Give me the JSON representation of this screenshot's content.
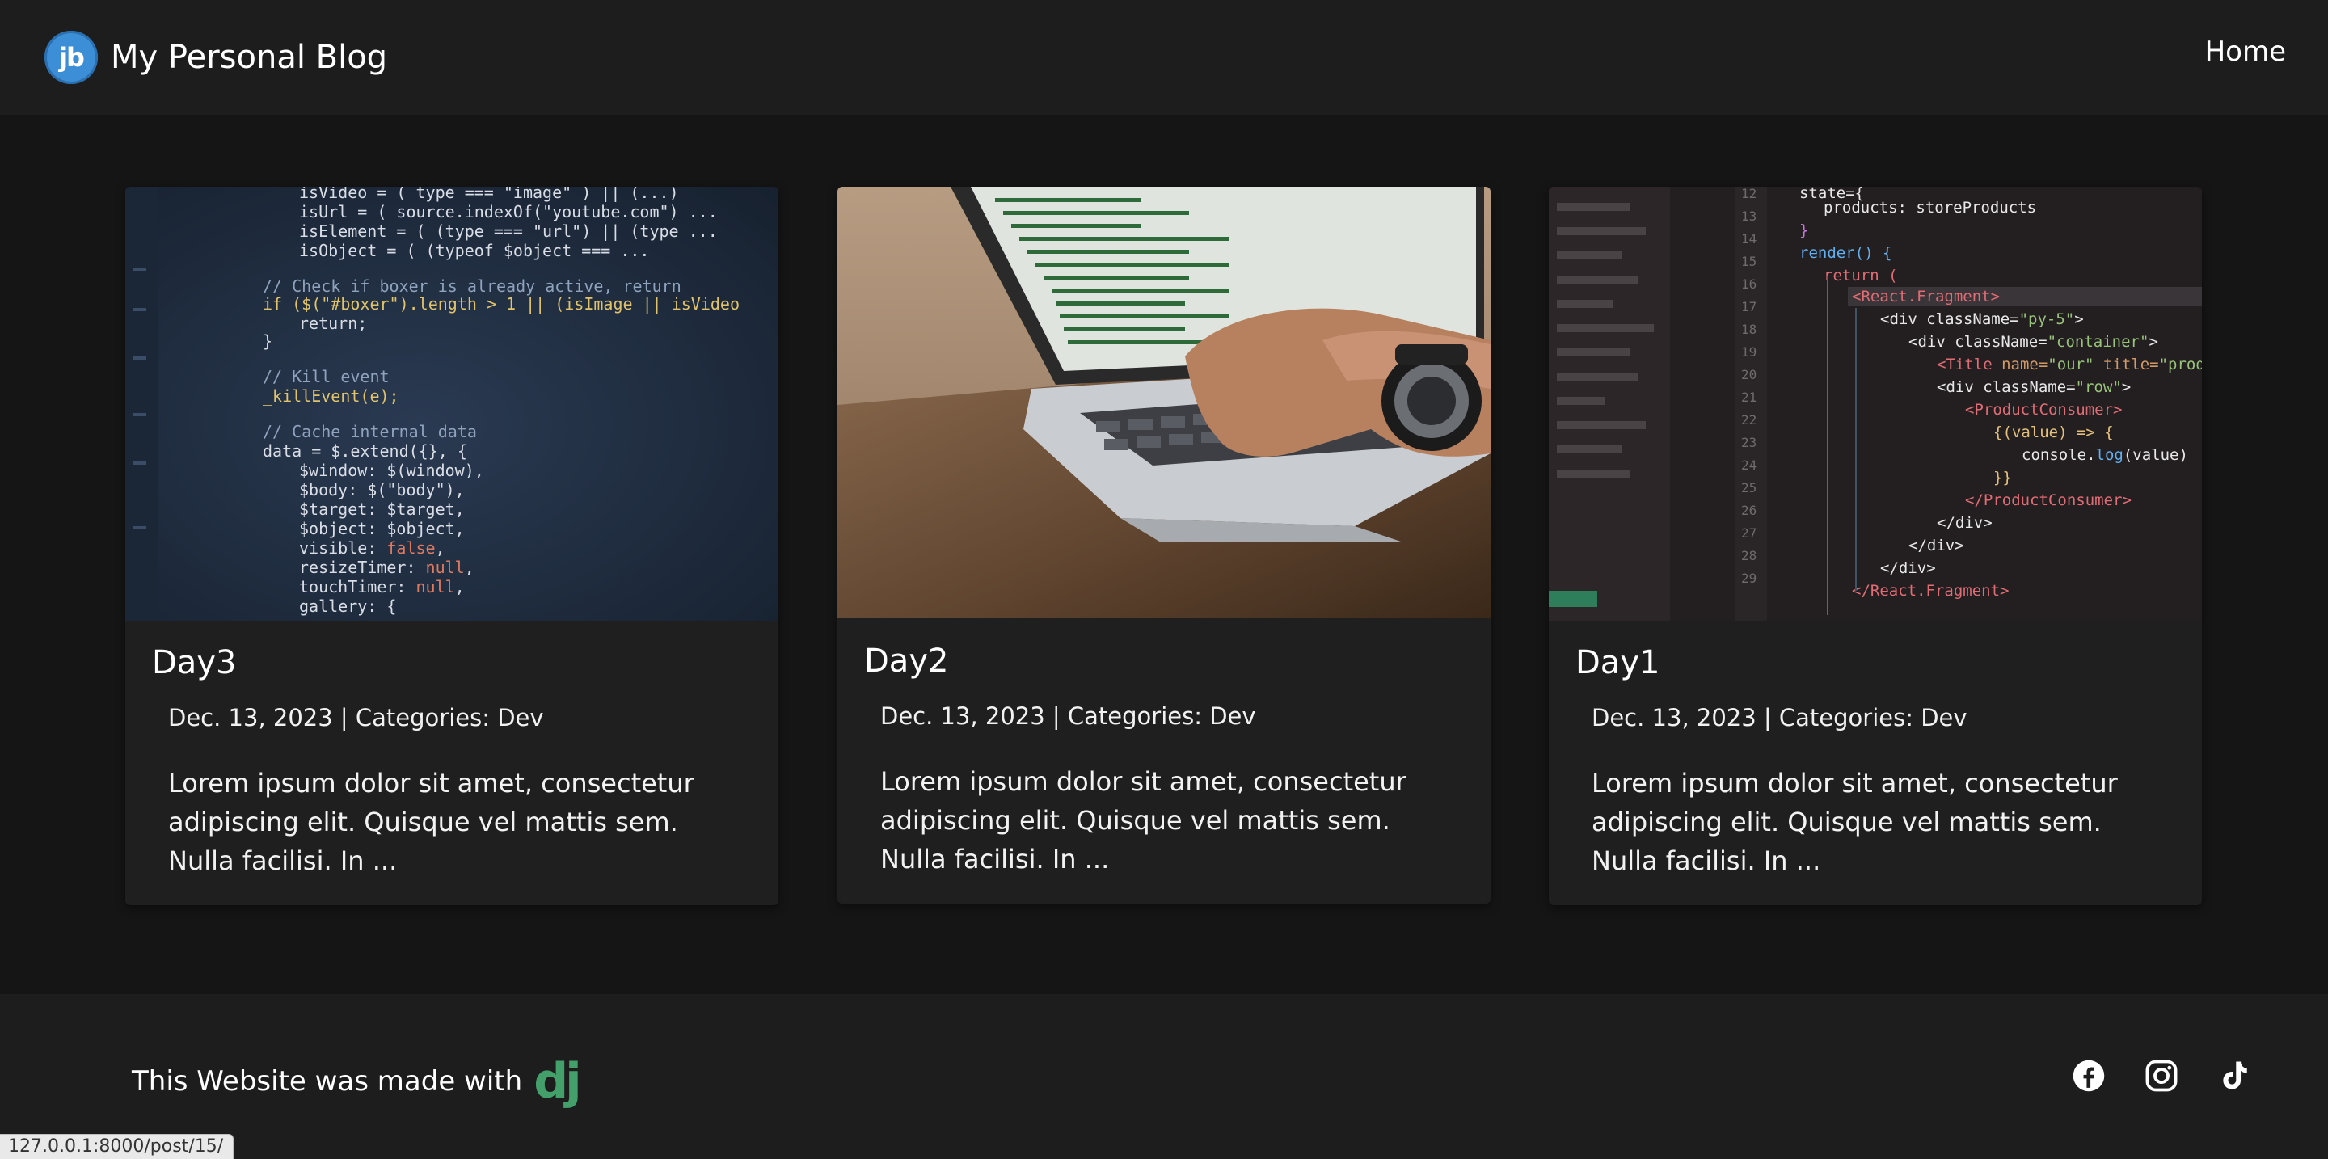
{
  "nav": {
    "logo_text": "jb",
    "brand": "My Personal Blog",
    "home_link": "Home"
  },
  "posts": [
    {
      "title": "Day3",
      "meta": "Dec. 13, 2023 | Categories: Dev",
      "excerpt": "Lorem ipsum dolor sit amet, consectetur adipiscing elit. Quisque vel mattis sem. Nulla facilisi. In ...",
      "image": "code-editor-javascript-screenshot"
    },
    {
      "title": "Day2",
      "meta": "Dec. 13, 2023 | Categories: Dev",
      "excerpt": "Lorem ipsum dolor sit amet, consectetur adipiscing elit. Quisque vel mattis sem. Nulla facilisi. In ...",
      "image": "hands-typing-on-laptop-photo"
    },
    {
      "title": "Day1",
      "meta": "Dec. 13, 2023 | Categories: Dev",
      "excerpt": "Lorem ipsum dolor sit amet, consectetur adipiscing elit. Quisque vel mattis sem. Nulla facilisi. In ...",
      "image": "react-code-screen-photo"
    }
  ],
  "footer": {
    "made_with": "This Website was made with",
    "framework_logo": "dj",
    "social_icons": [
      "facebook-icon",
      "instagram-icon",
      "tiktok-icon"
    ]
  },
  "status_bar": {
    "url": "127.0.0.1:8000/post/15/"
  },
  "colors": {
    "page_bg": "#151515",
    "bar_bg": "#1d1d1d",
    "card_bg": "#1f1f1f",
    "logo_blue": "#3c8fd6",
    "django_green": "#44a06b"
  }
}
